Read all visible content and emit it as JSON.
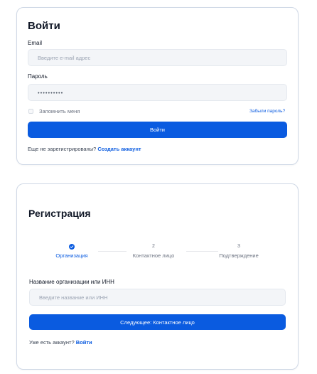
{
  "login": {
    "title": "Войти",
    "email_label": "Email",
    "email_placeholder": "Введите e-mail адрес",
    "password_label": "Пароль",
    "password_value": "••••••••••",
    "remember_label": "Запомнить меня",
    "forgot_link": "Забыли пароль?",
    "submit_label": "Войти",
    "no_account_text": "Еще не зарегистрированы?",
    "create_account_link": "Создать аккаунт"
  },
  "registration": {
    "title": "Регистрация",
    "steps": [
      {
        "marker": "",
        "label": "Организация",
        "state": "completed"
      },
      {
        "marker": "2",
        "label": "Контактное лицо",
        "state": "pending"
      },
      {
        "marker": "3",
        "label": "Подтверждение",
        "state": "pending"
      }
    ],
    "org_label": "Название организации или ИНН",
    "org_placeholder": "Введите название или ИНН",
    "next_label": "Следующее: Контактное лицо",
    "have_account_text": "Уже есть аккаунт?",
    "login_link": "Войти"
  },
  "colors": {
    "accent": "#0a5be0",
    "border": "#cfd8e6",
    "field_bg": "#f3f5f8"
  }
}
